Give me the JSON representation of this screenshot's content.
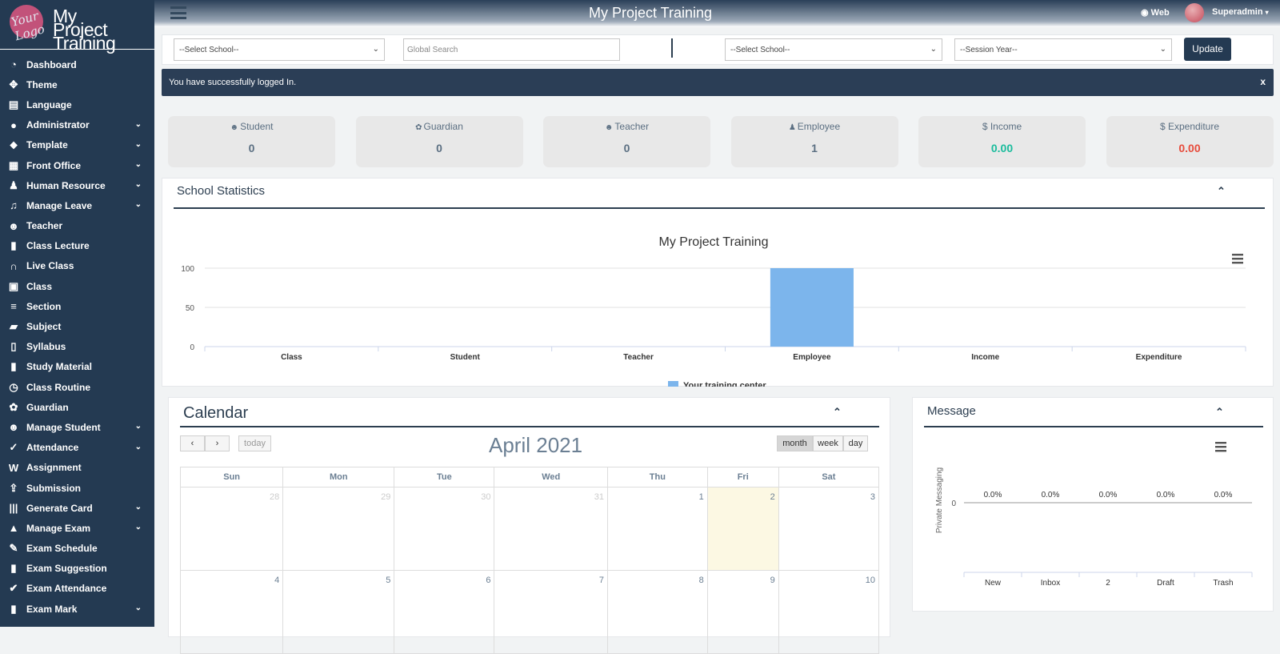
{
  "brand": {
    "logo_text": "Your Logo",
    "app_name_line1": "My",
    "app_name_line2": "Project",
    "app_name_line3": "Training"
  },
  "sidebar": {
    "items": [
      {
        "label": "Dashboard",
        "icon": "dashboard-icon",
        "glyph": "◔",
        "expandable": false
      },
      {
        "label": "Theme",
        "icon": "theme-icon",
        "glyph": "✥",
        "expandable": false
      },
      {
        "label": "Language",
        "icon": "language-icon",
        "glyph": "▤",
        "expandable": false
      },
      {
        "label": "Administrator",
        "icon": "user-icon",
        "glyph": "●",
        "expandable": true
      },
      {
        "label": "Template",
        "icon": "tags-icon",
        "glyph": "⬥",
        "expandable": true
      },
      {
        "label": "Front Office",
        "icon": "building-icon",
        "glyph": "▦",
        "expandable": true
      },
      {
        "label": "Human Resource",
        "icon": "user-tie-icon",
        "glyph": "♟",
        "expandable": true
      },
      {
        "label": "Manage Leave",
        "icon": "bell-icon",
        "glyph": "♫",
        "expandable": true
      },
      {
        "label": "Teacher",
        "icon": "users-icon",
        "glyph": "☻",
        "expandable": false
      },
      {
        "label": "Class Lecture",
        "icon": "file-icon",
        "glyph": "▮",
        "expandable": false
      },
      {
        "label": "Live Class",
        "icon": "headset-icon",
        "glyph": "∩",
        "expandable": false
      },
      {
        "label": "Class",
        "icon": "class-icon",
        "glyph": "▣",
        "expandable": false
      },
      {
        "label": "Section",
        "icon": "bars-icon",
        "glyph": "≡",
        "expandable": false
      },
      {
        "label": "Subject",
        "icon": "folder-icon",
        "glyph": "▰",
        "expandable": false
      },
      {
        "label": "Syllabus",
        "icon": "files-icon",
        "glyph": "▯",
        "expandable": false
      },
      {
        "label": "Study Material",
        "icon": "document-icon",
        "glyph": "▮",
        "expandable": false
      },
      {
        "label": "Class Routine",
        "icon": "clock-icon",
        "glyph": "◷",
        "expandable": false
      },
      {
        "label": "Guardian",
        "icon": "paw-icon",
        "glyph": "✿",
        "expandable": false
      },
      {
        "label": "Manage Student",
        "icon": "users-group-icon",
        "glyph": "☻",
        "expandable": true
      },
      {
        "label": "Attendance",
        "icon": "check-circle-icon",
        "glyph": "✓",
        "expandable": true
      },
      {
        "label": "Assignment",
        "icon": "word-file-icon",
        "glyph": "W",
        "expandable": false
      },
      {
        "label": "Submission",
        "icon": "upload-icon",
        "glyph": "⇪",
        "expandable": false
      },
      {
        "label": "Generate Card",
        "icon": "barcode-icon",
        "glyph": "|||",
        "expandable": true
      },
      {
        "label": "Manage Exam",
        "icon": "graduation-cap-icon",
        "glyph": "▲",
        "expandable": true
      },
      {
        "label": "Exam Schedule",
        "icon": "thumbtack-icon",
        "glyph": "✎",
        "expandable": false
      },
      {
        "label": "Exam Suggestion",
        "icon": "file-alt-icon",
        "glyph": "▮",
        "expandable": false
      },
      {
        "label": "Exam Attendance",
        "icon": "check-icon",
        "glyph": "✔",
        "expandable": false
      },
      {
        "label": "Exam Mark",
        "icon": "file-text-icon",
        "glyph": "▮",
        "expandable": true
      }
    ]
  },
  "topbar": {
    "title": "My Project Training",
    "web_label": "Web",
    "user_name": "Superadmin"
  },
  "filters": {
    "school_select_1": "--Select School--",
    "search_placeholder": "Global Search",
    "school_select_2": "--Select School--",
    "session_select": "--Session Year--",
    "update_label": "Update"
  },
  "alert": {
    "message": "You have successfully logged In.",
    "close": "x"
  },
  "stats": [
    {
      "label": "Student",
      "value": "0",
      "icon": "users-icon",
      "glyph": "☻",
      "color": "#5b6f82"
    },
    {
      "label": "Guardian",
      "value": "0",
      "icon": "paw-icon",
      "glyph": "✿",
      "color": "#5b6f82"
    },
    {
      "label": "Teacher",
      "value": "0",
      "icon": "users-icon",
      "glyph": "☻",
      "color": "#5b6f82"
    },
    {
      "label": "Employee",
      "value": "1",
      "icon": "user-tie-icon",
      "glyph": "♟",
      "color": "#5b6f82"
    },
    {
      "label": "$ Income",
      "value": "0.00",
      "icon": "",
      "glyph": "",
      "color": "#1abc9c"
    },
    {
      "label": "$ Expenditure",
      "value": "0.00",
      "icon": "",
      "glyph": "",
      "color": "#e74c3c"
    }
  ],
  "school_statistics": {
    "panel_title": "School Statistics"
  },
  "chart_data": [
    {
      "type": "bar",
      "title": "My Project Training",
      "categories": [
        "Class",
        "Student",
        "Teacher",
        "Employee",
        "Income",
        "Expenditure"
      ],
      "series": [
        {
          "name": "Your training center",
          "values": [
            0,
            0,
            0,
            100,
            0,
            0
          ],
          "color": "#7cb5ec"
        }
      ],
      "yticks": [
        0,
        50,
        100
      ],
      "ylim": [
        0,
        100
      ],
      "grid": true,
      "legend": "bottom-center"
    },
    {
      "type": "bar",
      "title": "",
      "categories": [
        "New",
        "Inbox",
        "2",
        "Draft",
        "Trash"
      ],
      "series": [
        {
          "values": [
            0,
            0,
            0,
            0,
            0
          ],
          "data_labels": [
            "0.0%",
            "0.0%",
            "0.0%",
            "0.0%",
            "0.0%"
          ]
        }
      ],
      "ylabel": "Private Messaging",
      "yticks": [
        0
      ],
      "grid": true
    }
  ],
  "calendar": {
    "panel_title": "Calendar",
    "month_label": "April 2021",
    "today_label": "today",
    "prev": "‹",
    "next": "›",
    "views": [
      "month",
      "week",
      "day"
    ],
    "active_view": "month",
    "weekdays": [
      "Sun",
      "Mon",
      "Tue",
      "Wed",
      "Thu",
      "Fri",
      "Sat"
    ],
    "weeks": [
      [
        {
          "d": "28",
          "o": true
        },
        {
          "d": "29",
          "o": true
        },
        {
          "d": "30",
          "o": true
        },
        {
          "d": "31",
          "o": true
        },
        {
          "d": "1"
        },
        {
          "d": "2",
          "today": true
        },
        {
          "d": "3"
        }
      ],
      [
        {
          "d": "4"
        },
        {
          "d": "5"
        },
        {
          "d": "6"
        },
        {
          "d": "7"
        },
        {
          "d": "8"
        },
        {
          "d": "9"
        },
        {
          "d": "10"
        }
      ]
    ]
  },
  "message": {
    "panel_title": "Message"
  }
}
